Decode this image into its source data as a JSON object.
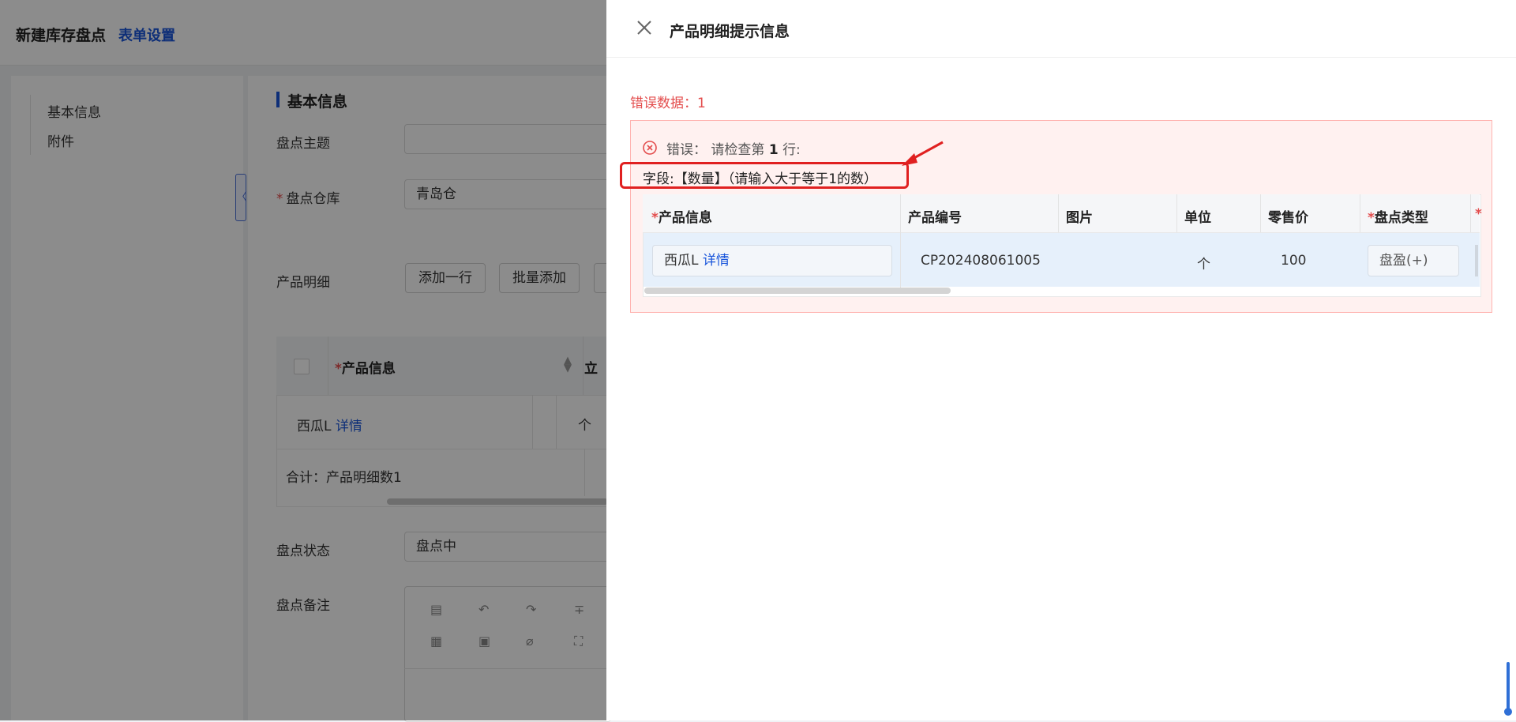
{
  "page": {
    "title": "新建库存盘点",
    "form_settings_link": "表单设置"
  },
  "sidebar": {
    "items": [
      {
        "label": "基本信息"
      },
      {
        "label": "附件"
      }
    ],
    "collapse_glyph": "〈"
  },
  "form": {
    "section_title": "基本信息",
    "subject_label": "盘点主题",
    "subject_value": "",
    "warehouse_required": "*",
    "warehouse_label": "盘点仓库",
    "warehouse_value": "青岛仓",
    "details_label": "产品明细",
    "add_row_button": "添加一行",
    "batch_add_button": "批量添加",
    "table": {
      "required": "*",
      "col_product": "产品信息",
      "col_clipped": "立",
      "row_product": "西瓜L",
      "row_detail_link": "详情",
      "row_unit": "个",
      "summary": "合计：产品明细数1"
    },
    "status_label": "盘点状态",
    "status_value": "盘点中",
    "remark_label": "盘点备注"
  },
  "drawer": {
    "title": "产品明细提示信息",
    "error_count_text": "错误数据：1",
    "error_prefix": "错误：",
    "error_check": "请检查第",
    "error_row": "1",
    "error_suffix": "行:",
    "field_error": "字段:【数量】（请输入大于等于1的数）",
    "table": {
      "required": "*",
      "headers": {
        "product": "产品信息",
        "code": "产品编号",
        "image": "图片",
        "unit": "单位",
        "price": "零售价",
        "type": "盘点类型"
      },
      "row": {
        "product_name": "西瓜L",
        "detail_link": "详情",
        "code": "CP202408061005",
        "image": "",
        "unit": "个",
        "price": "100",
        "type": "盘盈(+)"
      }
    }
  },
  "colors": {
    "accent": "#1a56db",
    "error": "#e34d4d",
    "error_bg": "#fff1f0",
    "highlight": "#e02020"
  }
}
